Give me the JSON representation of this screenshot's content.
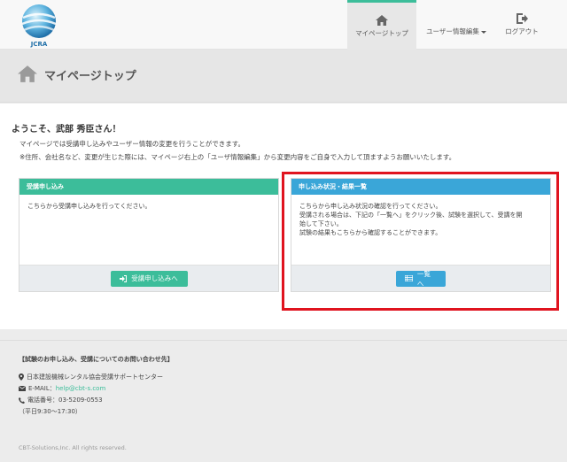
{
  "brand": {
    "logo_text": "JCRA",
    "accent_color": "#3cbd9a",
    "info_color": "#3aa6d8",
    "highlight_color": "#e0141f"
  },
  "nav": {
    "items": [
      {
        "label": "マイページトップ",
        "icon": "home-icon",
        "active": true
      },
      {
        "label": "ユーザー情報編集",
        "icon": "user-edit-icon",
        "dropdown": true
      },
      {
        "label": "ログアウト",
        "icon": "logout-icon"
      }
    ]
  },
  "page_header": {
    "title": "マイページトップ",
    "icon": "home-icon"
  },
  "main": {
    "welcome": "ようこそ、武部 秀臣さん！",
    "intro_line1": "マイページでは受講申し込みやユーザー情報の変更を行うことができます。",
    "intro_line2": "※住所、会社名など、変更が生じた際には、マイページ右上の「ユーザ情報編集」から変更内容をご自身で入力して頂ますようお願いいたします。",
    "panels": [
      {
        "heading": "受講申し込み",
        "body": [
          "こちらから受講申し込みを行ってください。"
        ],
        "button_label": "受講申し込みへ",
        "button_icon": "sign-in-icon"
      },
      {
        "heading": "申し込み状況・結果一覧",
        "body": [
          "こちらから申し込み状況の確認を行ってください。",
          "受講される場合は、下記の「一覧へ」をクリック後、試験を選択して、受講を開",
          "始して下さい。",
          "試験の結果もこちらから確認することができます。"
        ],
        "button_label": "一覧へ",
        "button_icon": "list-icon"
      }
    ]
  },
  "footer": {
    "contact_title": "【試験のお申し込み、受講についてのお問い合わせ先】",
    "org": "日本建設機械レンタル協会受講サポートセンター",
    "email_label": "E-MAIL：",
    "email": "help@cbt-s.com",
    "phone": "電話番号：03-5209-0553",
    "hours": "（平日9:30〜17:30）",
    "copyright": "CBT-Solutions,Inc. All rights reserved."
  }
}
